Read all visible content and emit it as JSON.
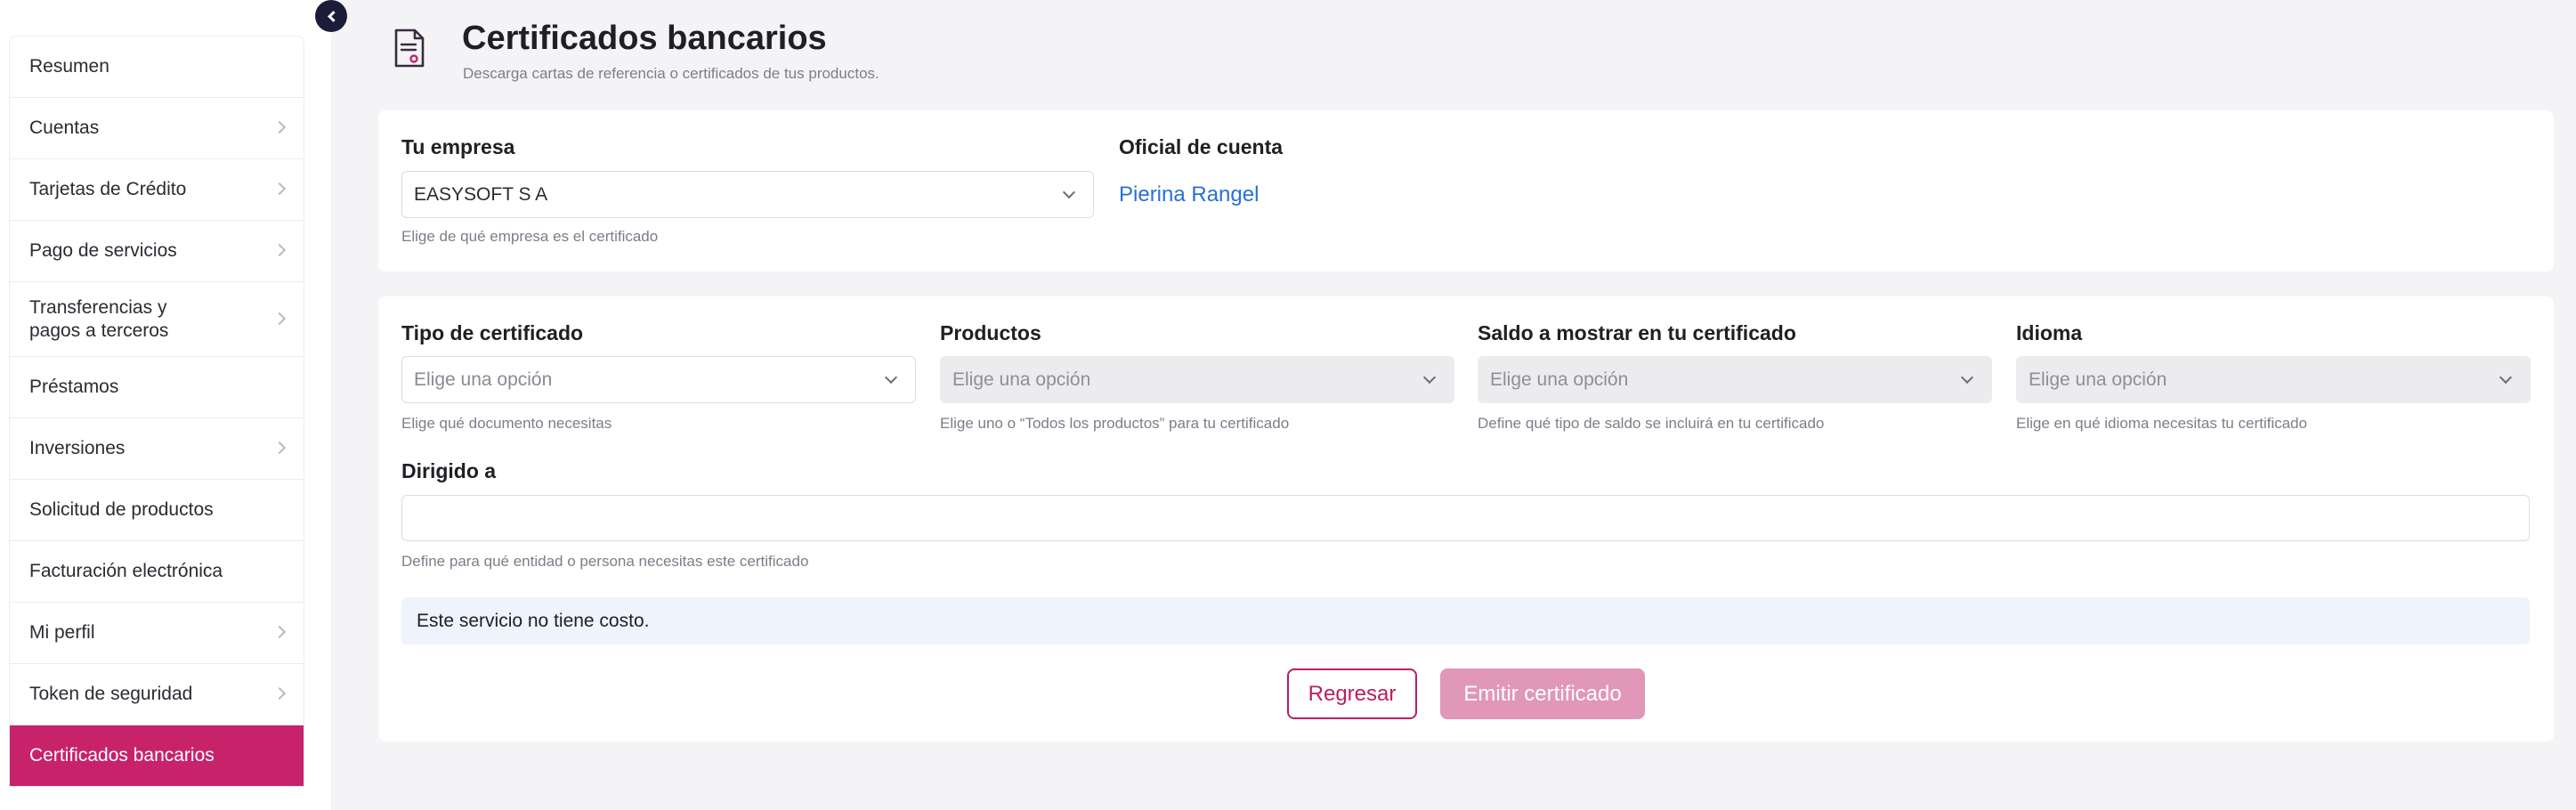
{
  "sidebar": {
    "items": [
      {
        "label": "Resumen",
        "has_arrow": false
      },
      {
        "label": "Cuentas",
        "has_arrow": true
      },
      {
        "label": "Tarjetas de Crédito",
        "has_arrow": true
      },
      {
        "label": "Pago de servicios",
        "has_arrow": true
      },
      {
        "label": "Transferencias y pagos a terceros",
        "line1": "Transferencias y",
        "line2": "pagos a terceros",
        "has_arrow": true
      },
      {
        "label": "Préstamos",
        "has_arrow": false
      },
      {
        "label": "Inversiones",
        "has_arrow": true
      },
      {
        "label": "Solicitud de productos",
        "has_arrow": false
      },
      {
        "label": "Facturación electrónica",
        "has_arrow": false
      },
      {
        "label": "Mi perfil",
        "has_arrow": true
      },
      {
        "label": "Token de seguridad",
        "has_arrow": true
      },
      {
        "label": "Certificados bancarios",
        "has_arrow": false,
        "active": true
      }
    ]
  },
  "header": {
    "title": "Certificados bancarios",
    "subtitle": "Descarga cartas de referencia o certificados de tus productos."
  },
  "company": {
    "label": "Tu empresa",
    "value": "EASYSOFT S A",
    "helper": "Elige de qué empresa es el certificado"
  },
  "officer": {
    "label": "Oficial de cuenta",
    "name": "Pierina Rangel"
  },
  "form": {
    "certificate_type": {
      "label": "Tipo de certificado",
      "placeholder": "Elige una opción",
      "helper": "Elige qué documento necesitas"
    },
    "products": {
      "label": "Productos",
      "placeholder": "Elige una opción",
      "helper": "Elige uno o “Todos los productos” para tu certificado"
    },
    "balance": {
      "label": "Saldo a mostrar en tu certificado",
      "placeholder": "Elige una opción",
      "helper": "Define qué tipo de saldo se incluirá en tu certificado"
    },
    "language": {
      "label": "Idioma",
      "placeholder": "Elige una opción",
      "helper": "Elige en qué idioma necesitas tu certificado"
    },
    "addressed_to": {
      "label": "Dirigido a",
      "value": "",
      "helper": "Define para qué entidad o persona necesitas este certificado"
    }
  },
  "notice": "Este servicio no tiene costo.",
  "buttons": {
    "back": "Regresar",
    "emit": "Emitir certificado"
  },
  "colors": {
    "accent": "#c7226a",
    "link": "#2a6fd6",
    "emit_disabled": "#e197b8",
    "notice_bg": "#eff3fb"
  }
}
